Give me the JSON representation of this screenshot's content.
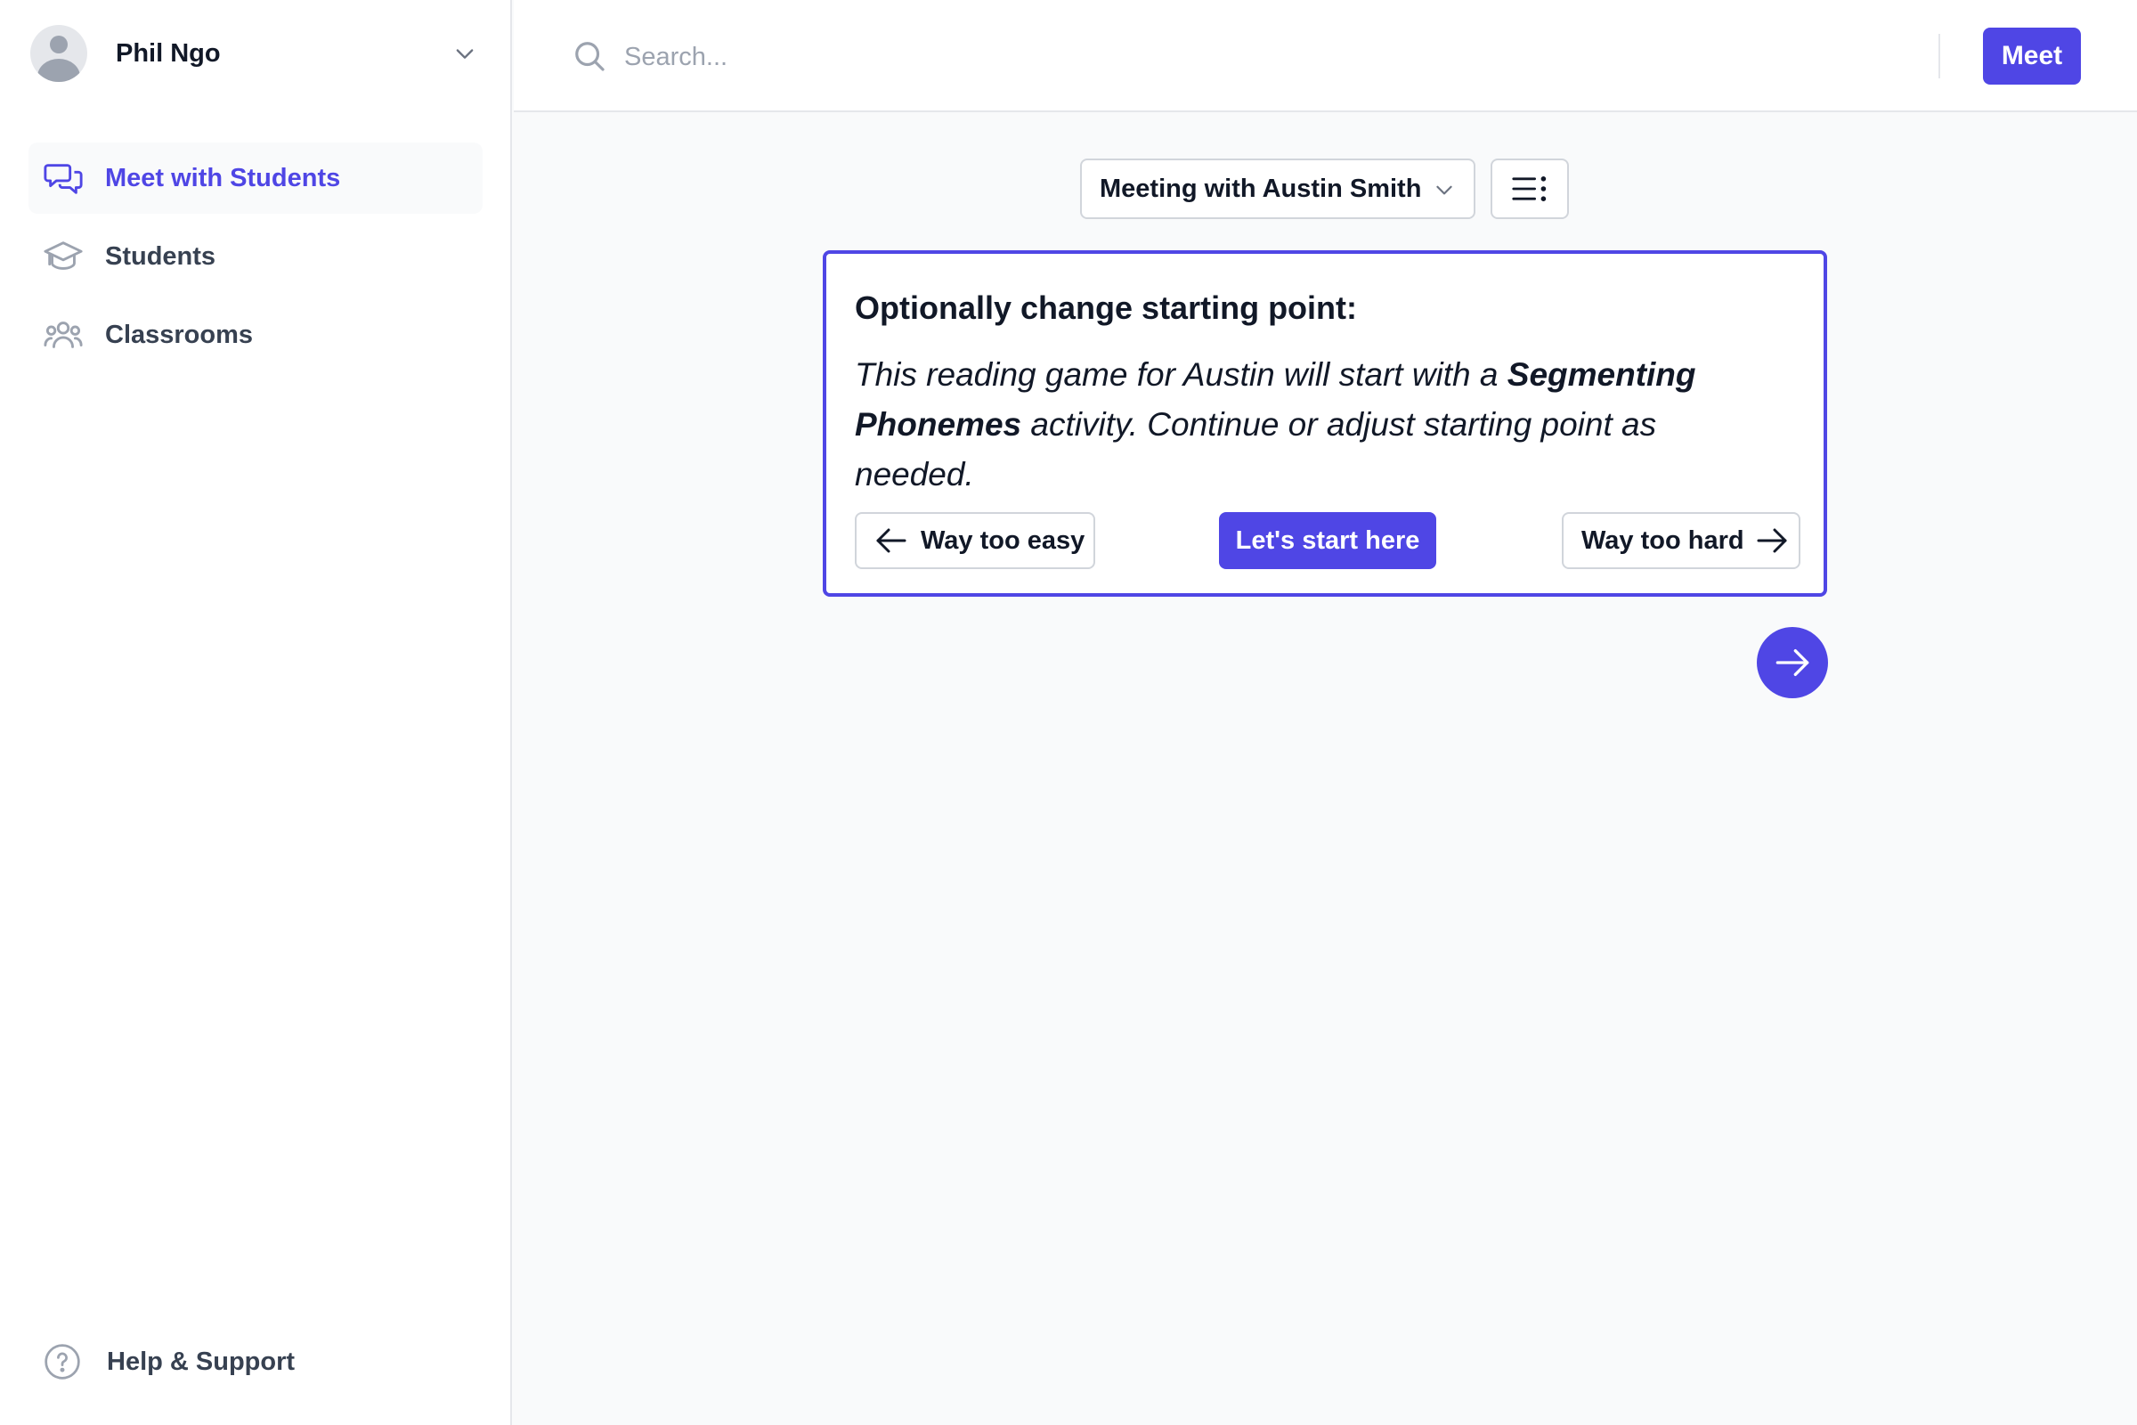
{
  "user": {
    "name": "Phil Ngo",
    "avatar_icon": "user-avatar-icon"
  },
  "sidebar": {
    "items": [
      {
        "label": "Meet with Students",
        "icon": "chat-bubbles-icon",
        "active": true
      },
      {
        "label": "Students",
        "icon": "graduation-cap-icon",
        "active": false
      },
      {
        "label": "Classrooms",
        "icon": "users-group-icon",
        "active": false
      }
    ],
    "help": {
      "label": "Help & Support",
      "icon": "question-circle-icon"
    }
  },
  "header": {
    "search": {
      "placeholder": "Search...",
      "value": ""
    },
    "meet_label": "Meet"
  },
  "main": {
    "meeting_select": {
      "selected": "Meeting with Austin Smith"
    },
    "card": {
      "title": "Optionally change starting point:",
      "body_part1": "This reading game for Austin will start with a ",
      "activity": "Segmenting Phonemes",
      "body_part2": " activity. Continue or adjust starting point as needed.",
      "easy_label": "Way too easy",
      "start_label": "Let's start here",
      "hard_label": "Way too hard"
    }
  },
  "colors": {
    "accent": "#4f46e5",
    "sidebar_bg": "#ffffff",
    "main_bg": "#f9fafb",
    "border": "#e5e7eb",
    "text": "#111827",
    "muted": "#9ca3af"
  }
}
